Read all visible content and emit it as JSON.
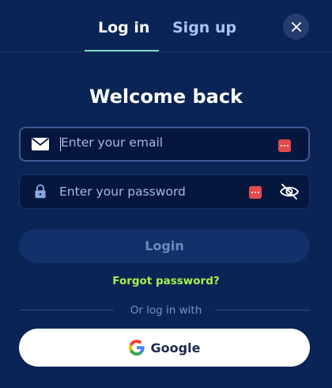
{
  "tabs": {
    "login_label": "Log in",
    "signup_label": "Sign up",
    "active": "login"
  },
  "close_icon": "close-icon",
  "title": "Welcome back",
  "email": {
    "placeholder": "Enter your email",
    "value": "",
    "icon": "envelope-icon"
  },
  "password": {
    "placeholder": "Enter your password",
    "value": "",
    "icon": "lock-icon",
    "visibility_icon": "eye-off-icon"
  },
  "login_button_label": "Login",
  "forgot_password_label": "Forgot password?",
  "divider_label": "Or log in with",
  "google_button": {
    "label": "Google",
    "icon": "google-logo-icon"
  },
  "colors": {
    "background": "#0b2456",
    "accent_link": "#a6f24a",
    "tab_underline": "#7edcc4",
    "password_manager_badge": "#e24b4b"
  }
}
